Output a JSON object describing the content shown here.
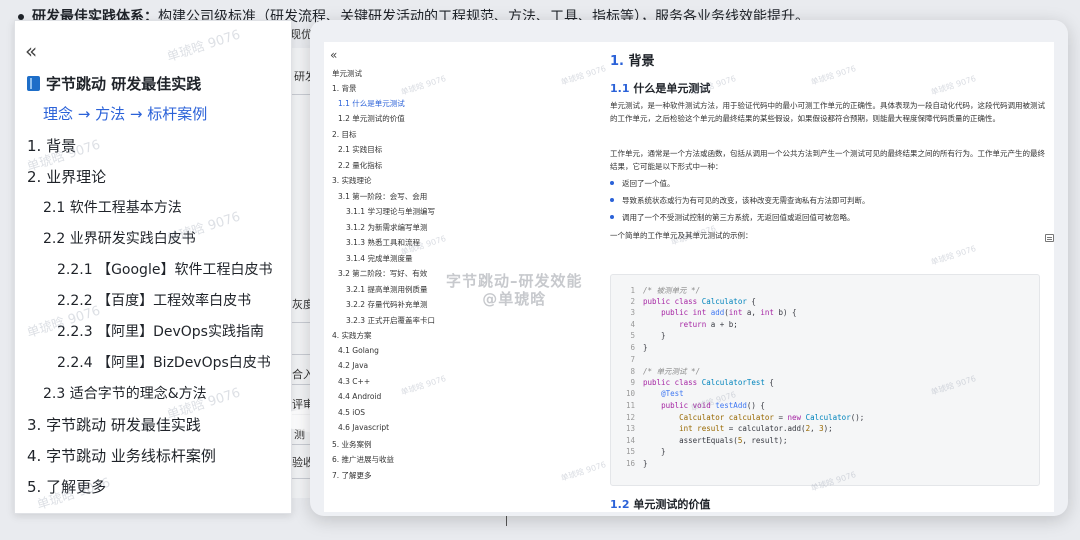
{
  "background": {
    "top_line_bold": "研发最佳实践体系：",
    "top_line_rest": "构建公司级标准（研发流程、关键研发活动的工程规范、方法、工具、指标等），服务各业务线效能提升。",
    "fragments": [
      "现优",
      "研发",
      "灰度",
      "合入",
      "评审",
      "测",
      "验收"
    ]
  },
  "left_panel": {
    "collapse_glyph": "«",
    "title": "字节跳动 研发最佳实践",
    "subtitle": "理念 → 方法 → 标杆案例",
    "items": [
      "1. 背景",
      "2. 业界理论",
      "2.1 软件工程基本方法",
      "2.2 业界研发实践白皮书",
      "2.2.1 【Google】软件工程白皮书",
      "2.2.2 【百度】工程效率白皮书",
      "2.2.3 【阿里】DevOps实践指南",
      "2.2.4 【阿里】BizDevOps白皮书",
      "2.3 适合字节的理念&方法",
      "3. 字节跳动 研发最佳实践",
      "4. 字节跳动 业务线标杆案例",
      "5. 了解更多"
    ]
  },
  "toc": {
    "collapse_glyph": "«",
    "items": [
      "单元测试",
      "1. 背景",
      "1.1 什么是单元测试",
      "1.2 单元测试的价值",
      "2. 目标",
      "2.1 实践目标",
      "2.2 量化指标",
      "3. 实践理论",
      "3.1 第一阶段：会写、会用",
      "3.1.1 学习理论与单测编写",
      "3.1.2 为新需求编写单测",
      "3.1.3 熟悉工具和流程",
      "3.1.4 完成单测度量",
      "3.2 第二阶段：写好、有效",
      "3.2.1 提高单测用例质量",
      "3.2.2 存量代码补充单测",
      "3.2.3 正式开启覆盖率卡口",
      "4. 实践方案",
      "4.1 Golang",
      "4.2 Java",
      "4.3 C++",
      "4.4 Android",
      "4.5 iOS",
      "4.6 Javascript",
      "5. 业务案例",
      "6. 推广进展与收益",
      "7. 了解更多"
    ]
  },
  "content": {
    "h1_num": "1.",
    "h1_text": "背景",
    "h2a_num": "1.1",
    "h2a_text": "什么是单元测试",
    "p1": "单元测试，是一种软件测试方法，用于验证代码中的最小可测工作单元的正确性。具体表现为一段自动化代码，这段代码调用被测试的工作单元，之后检验这个单元的最终结果的某些假设，如果假设都符合预期，则能最大程度保障代码质量的正确性。",
    "p2": "工作单元，通常是一个方法或函数，包括从调用一个公共方法到产生一个测试可见的最终结果之间的所有行为。工作单元产生的最终结果，它可能是以下形式中一种：",
    "bullets": [
      "返回了一个值。",
      "导致系统状态或行为有可见的改变，该种改变无需查询私有方法即可判断。",
      "调用了一个不受测试控制的第三方系统，无返回值或返回值可被忽略。"
    ],
    "p3": "一个简单的工作单元及其单元测试的示例：",
    "h2b_num": "1.2",
    "h2b_text": "单元测试的价值"
  },
  "code": [
    {
      "ln": "1",
      "parts": [
        [
          "cm",
          "/* 被测单元 */"
        ]
      ]
    },
    {
      "ln": "2",
      "parts": [
        [
          "kw",
          "public class "
        ],
        [
          "ty",
          "Calculator"
        ],
        [
          "tx",
          " {"
        ]
      ]
    },
    {
      "ln": "3",
      "parts": [
        [
          "tx",
          "    "
        ],
        [
          "kw",
          "public int "
        ],
        [
          "fn",
          "add"
        ],
        [
          "tx",
          "("
        ],
        [
          "kw",
          "int "
        ],
        [
          "tx",
          "a, "
        ],
        [
          "kw",
          "int "
        ],
        [
          "tx",
          "b) {"
        ]
      ]
    },
    {
      "ln": "4",
      "parts": [
        [
          "tx",
          "        "
        ],
        [
          "kw",
          "return "
        ],
        [
          "tx",
          "a + b;"
        ]
      ]
    },
    {
      "ln": "5",
      "parts": [
        [
          "tx",
          "    }"
        ]
      ]
    },
    {
      "ln": "6",
      "parts": [
        [
          "tx",
          "}"
        ]
      ]
    },
    {
      "ln": "7",
      "parts": [
        [
          "tx",
          ""
        ]
      ]
    },
    {
      "ln": "8",
      "parts": [
        [
          "cm",
          "/* 单元测试 */"
        ]
      ]
    },
    {
      "ln": "9",
      "parts": [
        [
          "kw",
          "public class "
        ],
        [
          "ty",
          "CalculatorTest"
        ],
        [
          "tx",
          " {"
        ]
      ]
    },
    {
      "ln": "10",
      "parts": [
        [
          "tx",
          "    "
        ],
        [
          "an",
          "@Test"
        ]
      ]
    },
    {
      "ln": "11",
      "parts": [
        [
          "tx",
          "    "
        ],
        [
          "kw",
          "public void "
        ],
        [
          "fn",
          "testAdd"
        ],
        [
          "tx",
          "() {"
        ]
      ]
    },
    {
      "ln": "12",
      "parts": [
        [
          "tx",
          "        "
        ],
        [
          "nm",
          "Calculator calculator"
        ],
        [
          "tx",
          " = "
        ],
        [
          "kw",
          "new "
        ],
        [
          "ty",
          "Calculator"
        ],
        [
          "tx",
          "();"
        ]
      ]
    },
    {
      "ln": "13",
      "parts": [
        [
          "tx",
          "        "
        ],
        [
          "nm",
          "int result"
        ],
        [
          "tx",
          " = calculator.add("
        ],
        [
          "nm",
          "2"
        ],
        [
          "tx",
          ", "
        ],
        [
          "nm",
          "3"
        ],
        [
          "tx",
          ");"
        ]
      ]
    },
    {
      "ln": "14",
      "parts": [
        [
          "tx",
          "        assertEquals("
        ],
        [
          "nm",
          "5"
        ],
        [
          "tx",
          ", result);"
        ]
      ]
    },
    {
      "ln": "15",
      "parts": [
        [
          "tx",
          "    }"
        ]
      ]
    },
    {
      "ln": "16",
      "parts": [
        [
          "tx",
          "}"
        ]
      ]
    }
  ],
  "watermarks": {
    "small": "单琥晗 9076",
    "big_line1": "字节跳动–研发效能",
    "big_line2": "@单琥晗"
  }
}
